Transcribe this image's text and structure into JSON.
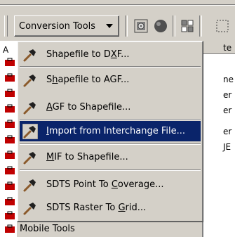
{
  "toolbar": {
    "dropdown_label": "Conversion Tools",
    "icons": [
      "map-icon",
      "record-icon",
      "layer-icon",
      "select-icon"
    ]
  },
  "menu": {
    "items": [
      {
        "pre": "Shapefile to D",
        "mn": "X",
        "post": "F...",
        "icon": "hammer-icon"
      },
      {
        "pre": "S",
        "mn": "h",
        "post": "apefile to AGF...",
        "icon": "hammer-icon"
      },
      {
        "pre": "",
        "mn": "A",
        "post": "GF to Shapefile...",
        "icon": "hammer-icon"
      },
      {
        "pre": "",
        "mn": "I",
        "post": "mport from Interchange File...",
        "icon": "hammer-icon",
        "selected": true
      },
      {
        "pre": "",
        "mn": "M",
        "post": "IF to Shapefile...",
        "icon": "hammer-icon"
      },
      {
        "pre": "SDTS Point To ",
        "mn": "C",
        "post": "overage...",
        "icon": "hammer-icon"
      },
      {
        "pre": "SDTS Raster To ",
        "mn": "G",
        "post": "rid...",
        "icon": "hammer-icon"
      }
    ]
  },
  "left_panel": {
    "caption": "A",
    "mobile_label": "Mobile Tools"
  },
  "right_panel": {
    "header": "te",
    "rows": [
      "ne",
      "er",
      "er",
      "er",
      "JE"
    ]
  },
  "colors": {
    "face": "#d4d0c8",
    "selection": "#0a246a"
  }
}
